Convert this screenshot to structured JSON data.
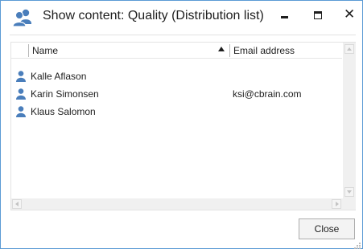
{
  "window": {
    "title": "Show content: Quality (Distribution list)",
    "title_icon": "users-group-icon",
    "controls": {
      "minimize_icon": "minimize-icon",
      "maximize_icon": "maximize-icon",
      "close_glyph": "✕"
    }
  },
  "list": {
    "columns": [
      {
        "label": "Name",
        "sorted": "ascending"
      },
      {
        "label": "Email address"
      }
    ],
    "rows": [
      {
        "name": "Kalle Aflason",
        "email": ""
      },
      {
        "name": "Karin Simonsen",
        "email": "ksi@cbrain.com"
      },
      {
        "name": "Klaus Salomon",
        "email": ""
      }
    ],
    "row_icon": "person-icon"
  },
  "footer": {
    "close_label": "Close"
  },
  "colors": {
    "accent": "#5b9bd5",
    "icon_blue": "#4a7ebb"
  }
}
